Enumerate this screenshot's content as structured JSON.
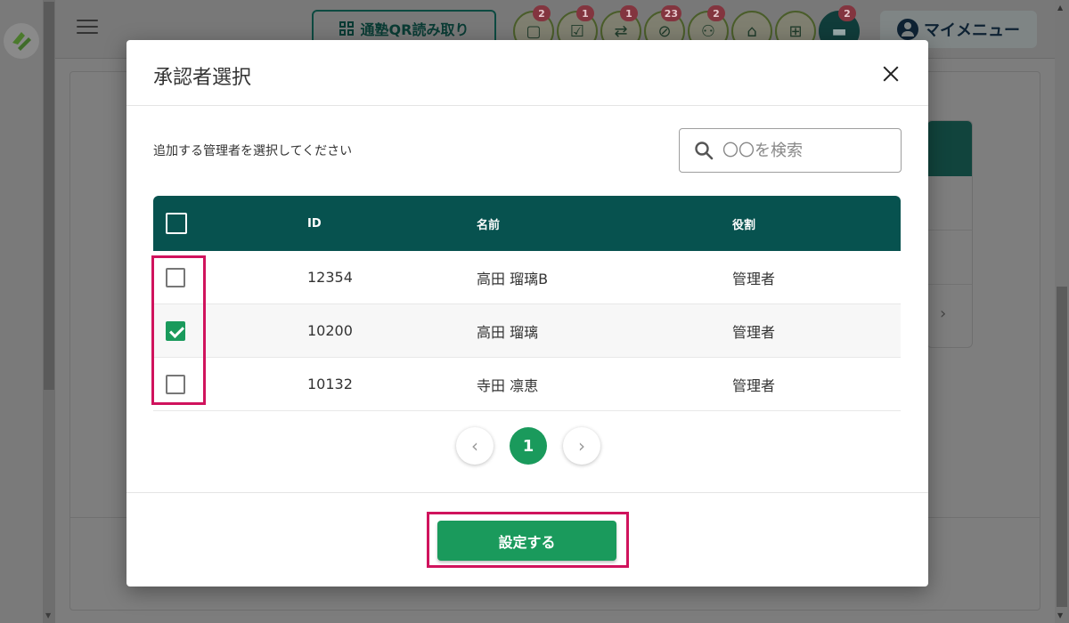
{
  "topbar": {
    "qr_label": "通塾QR読み取り",
    "nav_badges": [
      "2",
      "1",
      "1",
      "23",
      "2",
      "",
      "",
      "2"
    ],
    "my_menu": "マイメニュー"
  },
  "dialog": {
    "title": "承認者選択",
    "instruction": "追加する管理者を選択してください",
    "search_placeholder": "〇〇を検索",
    "columns": {
      "id": "ID",
      "name": "名前",
      "role": "役割"
    },
    "rows": [
      {
        "id": "12354",
        "name": "高田 瑠璃B",
        "role": "管理者",
        "checked": false
      },
      {
        "id": "10200",
        "name": "高田 瑠璃",
        "role": "管理者",
        "checked": true
      },
      {
        "id": "10132",
        "name": "寺田 凛恵",
        "role": "管理者",
        "checked": false
      }
    ],
    "pagination": {
      "current": "1"
    },
    "submit_label": "設定する"
  },
  "colors": {
    "header_teal": "#07524f",
    "accent_green": "#1a9a5c",
    "highlight_pink": "#d0135d"
  }
}
